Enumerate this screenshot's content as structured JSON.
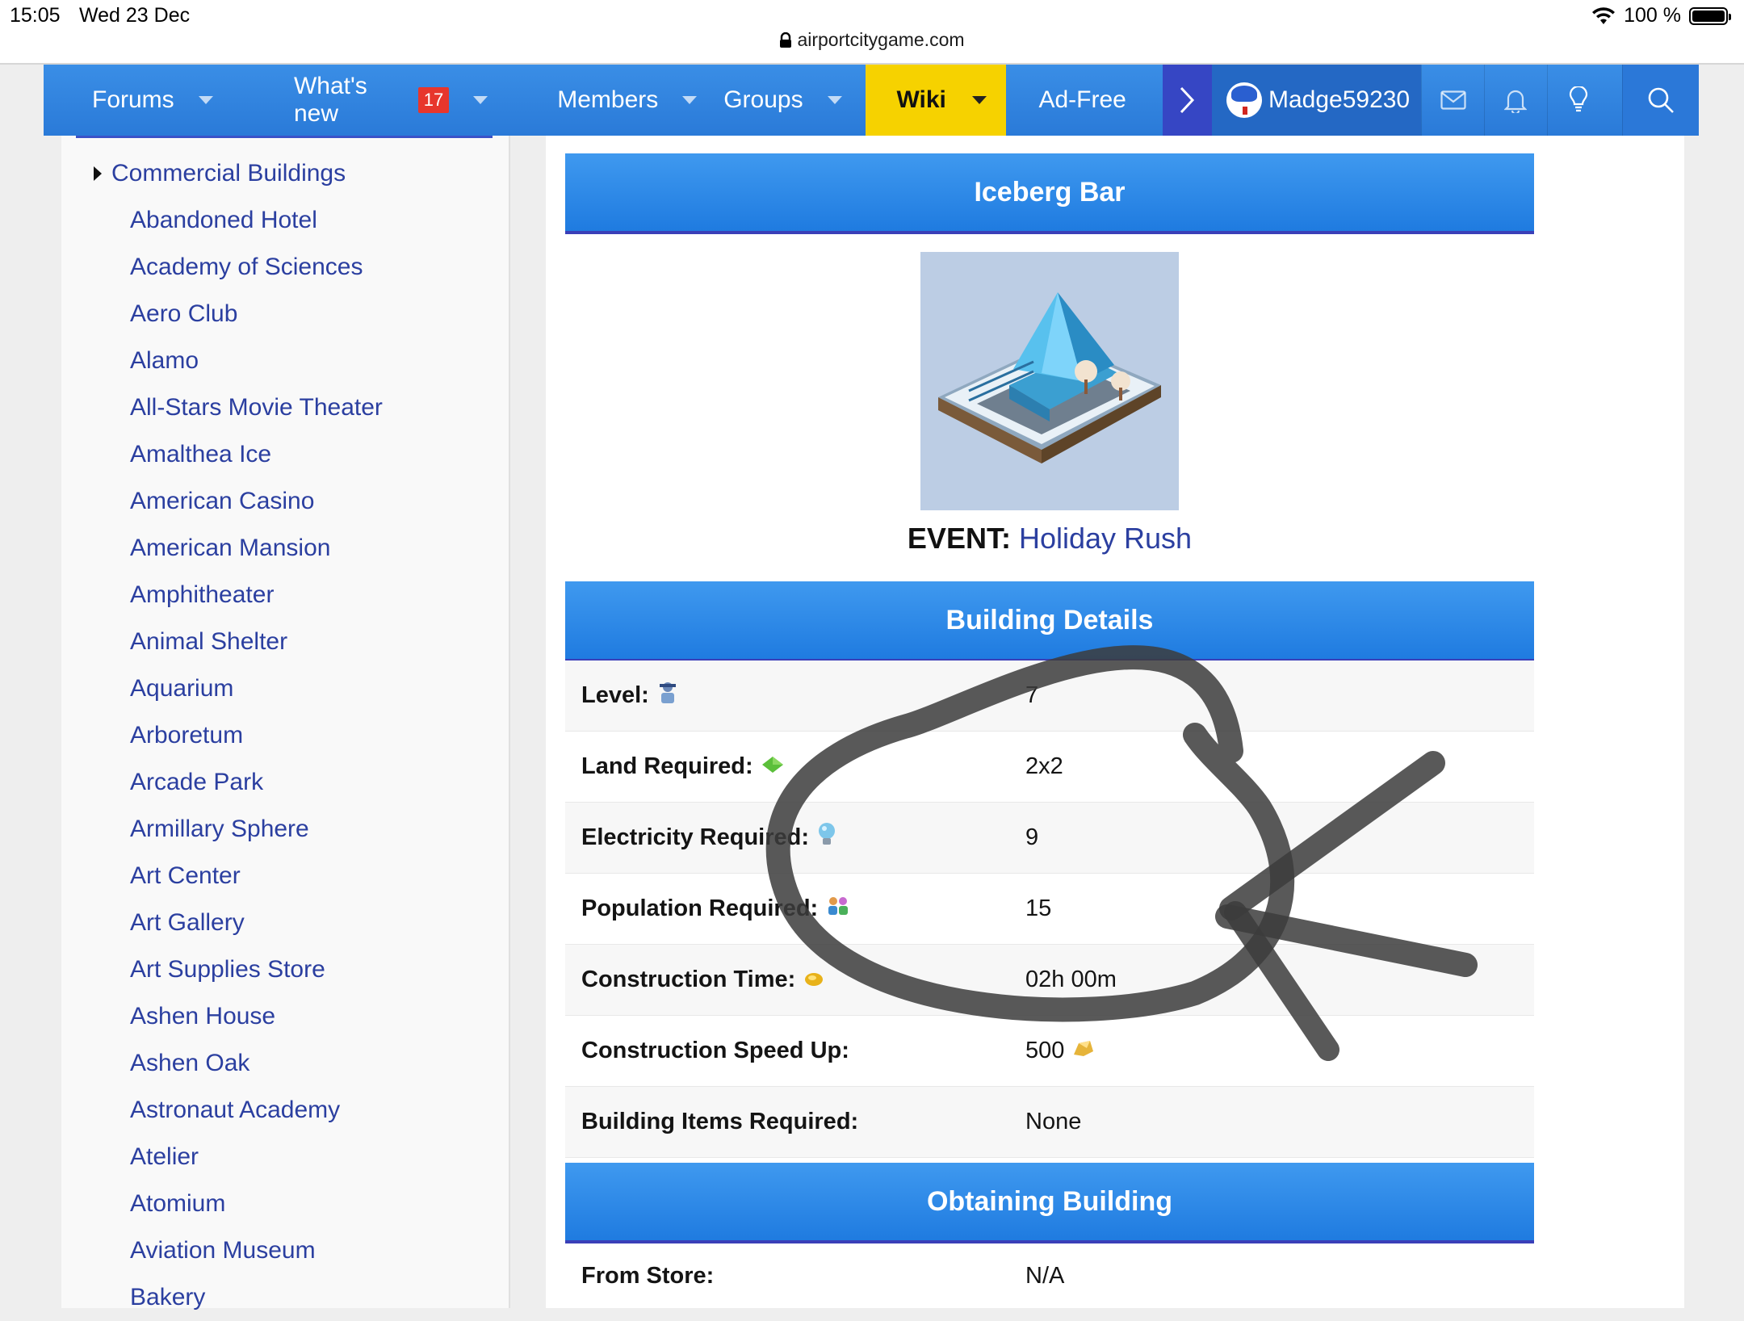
{
  "status_bar": {
    "time": "15:05",
    "date": "Wed 23 Dec",
    "battery": "100 %",
    "url": "airportcitygame.com"
  },
  "nav": {
    "forums": "Forums",
    "whats_new": "What's new",
    "whats_new_badge": "17",
    "members": "Members",
    "groups": "Groups",
    "wiki": "Wiki",
    "ad_free": "Ad-Free",
    "username": "Madge59230"
  },
  "sidebar": {
    "category": "Commercial Buildings",
    "items": [
      "Abandoned Hotel",
      "Academy of Sciences",
      "Aero Club",
      "Alamo",
      "All-Stars Movie Theater",
      "Amalthea Ice",
      "American Casino",
      "American Mansion",
      "Amphitheater",
      "Animal Shelter",
      "Aquarium",
      "Arboretum",
      "Arcade Park",
      "Armillary Sphere",
      "Art Center",
      "Art Gallery",
      "Art Supplies Store",
      "Ashen House",
      "Ashen Oak",
      "Astronaut Academy",
      "Atelier",
      "Atomium",
      "Aviation Museum",
      "Bakery"
    ]
  },
  "building": {
    "title": "Iceberg Bar",
    "event_label": "EVENT:",
    "event_value": "Holiday Rush"
  },
  "details": {
    "header": "Building Details",
    "rows": [
      {
        "label": "Level:",
        "value": "7",
        "icon": "level-icon"
      },
      {
        "label": "Land Required:",
        "value": "2x2",
        "icon": "land-icon"
      },
      {
        "label": "Electricity Required:",
        "value": "9",
        "icon": "electricity-icon"
      },
      {
        "label": "Population Required:",
        "value": "15",
        "icon": "population-icon"
      },
      {
        "label": "Construction Time:",
        "value": "02h 00m",
        "icon": "time-icon"
      },
      {
        "label": "Construction Speed Up:",
        "value": "500",
        "icon": "gold-icon"
      },
      {
        "label": "Building Items Required:",
        "value": "None",
        "icon": ""
      }
    ]
  },
  "obtaining": {
    "header": "Obtaining Building",
    "from_store_label": "From Store:",
    "from_store_value": "N/A"
  },
  "colors": {
    "nav_blue": "#2a7ad8",
    "wiki_yellow": "#f6d200",
    "link_blue": "#2b3fa0",
    "header_blue": "#1f7be0",
    "badge_red": "#e7362c"
  }
}
